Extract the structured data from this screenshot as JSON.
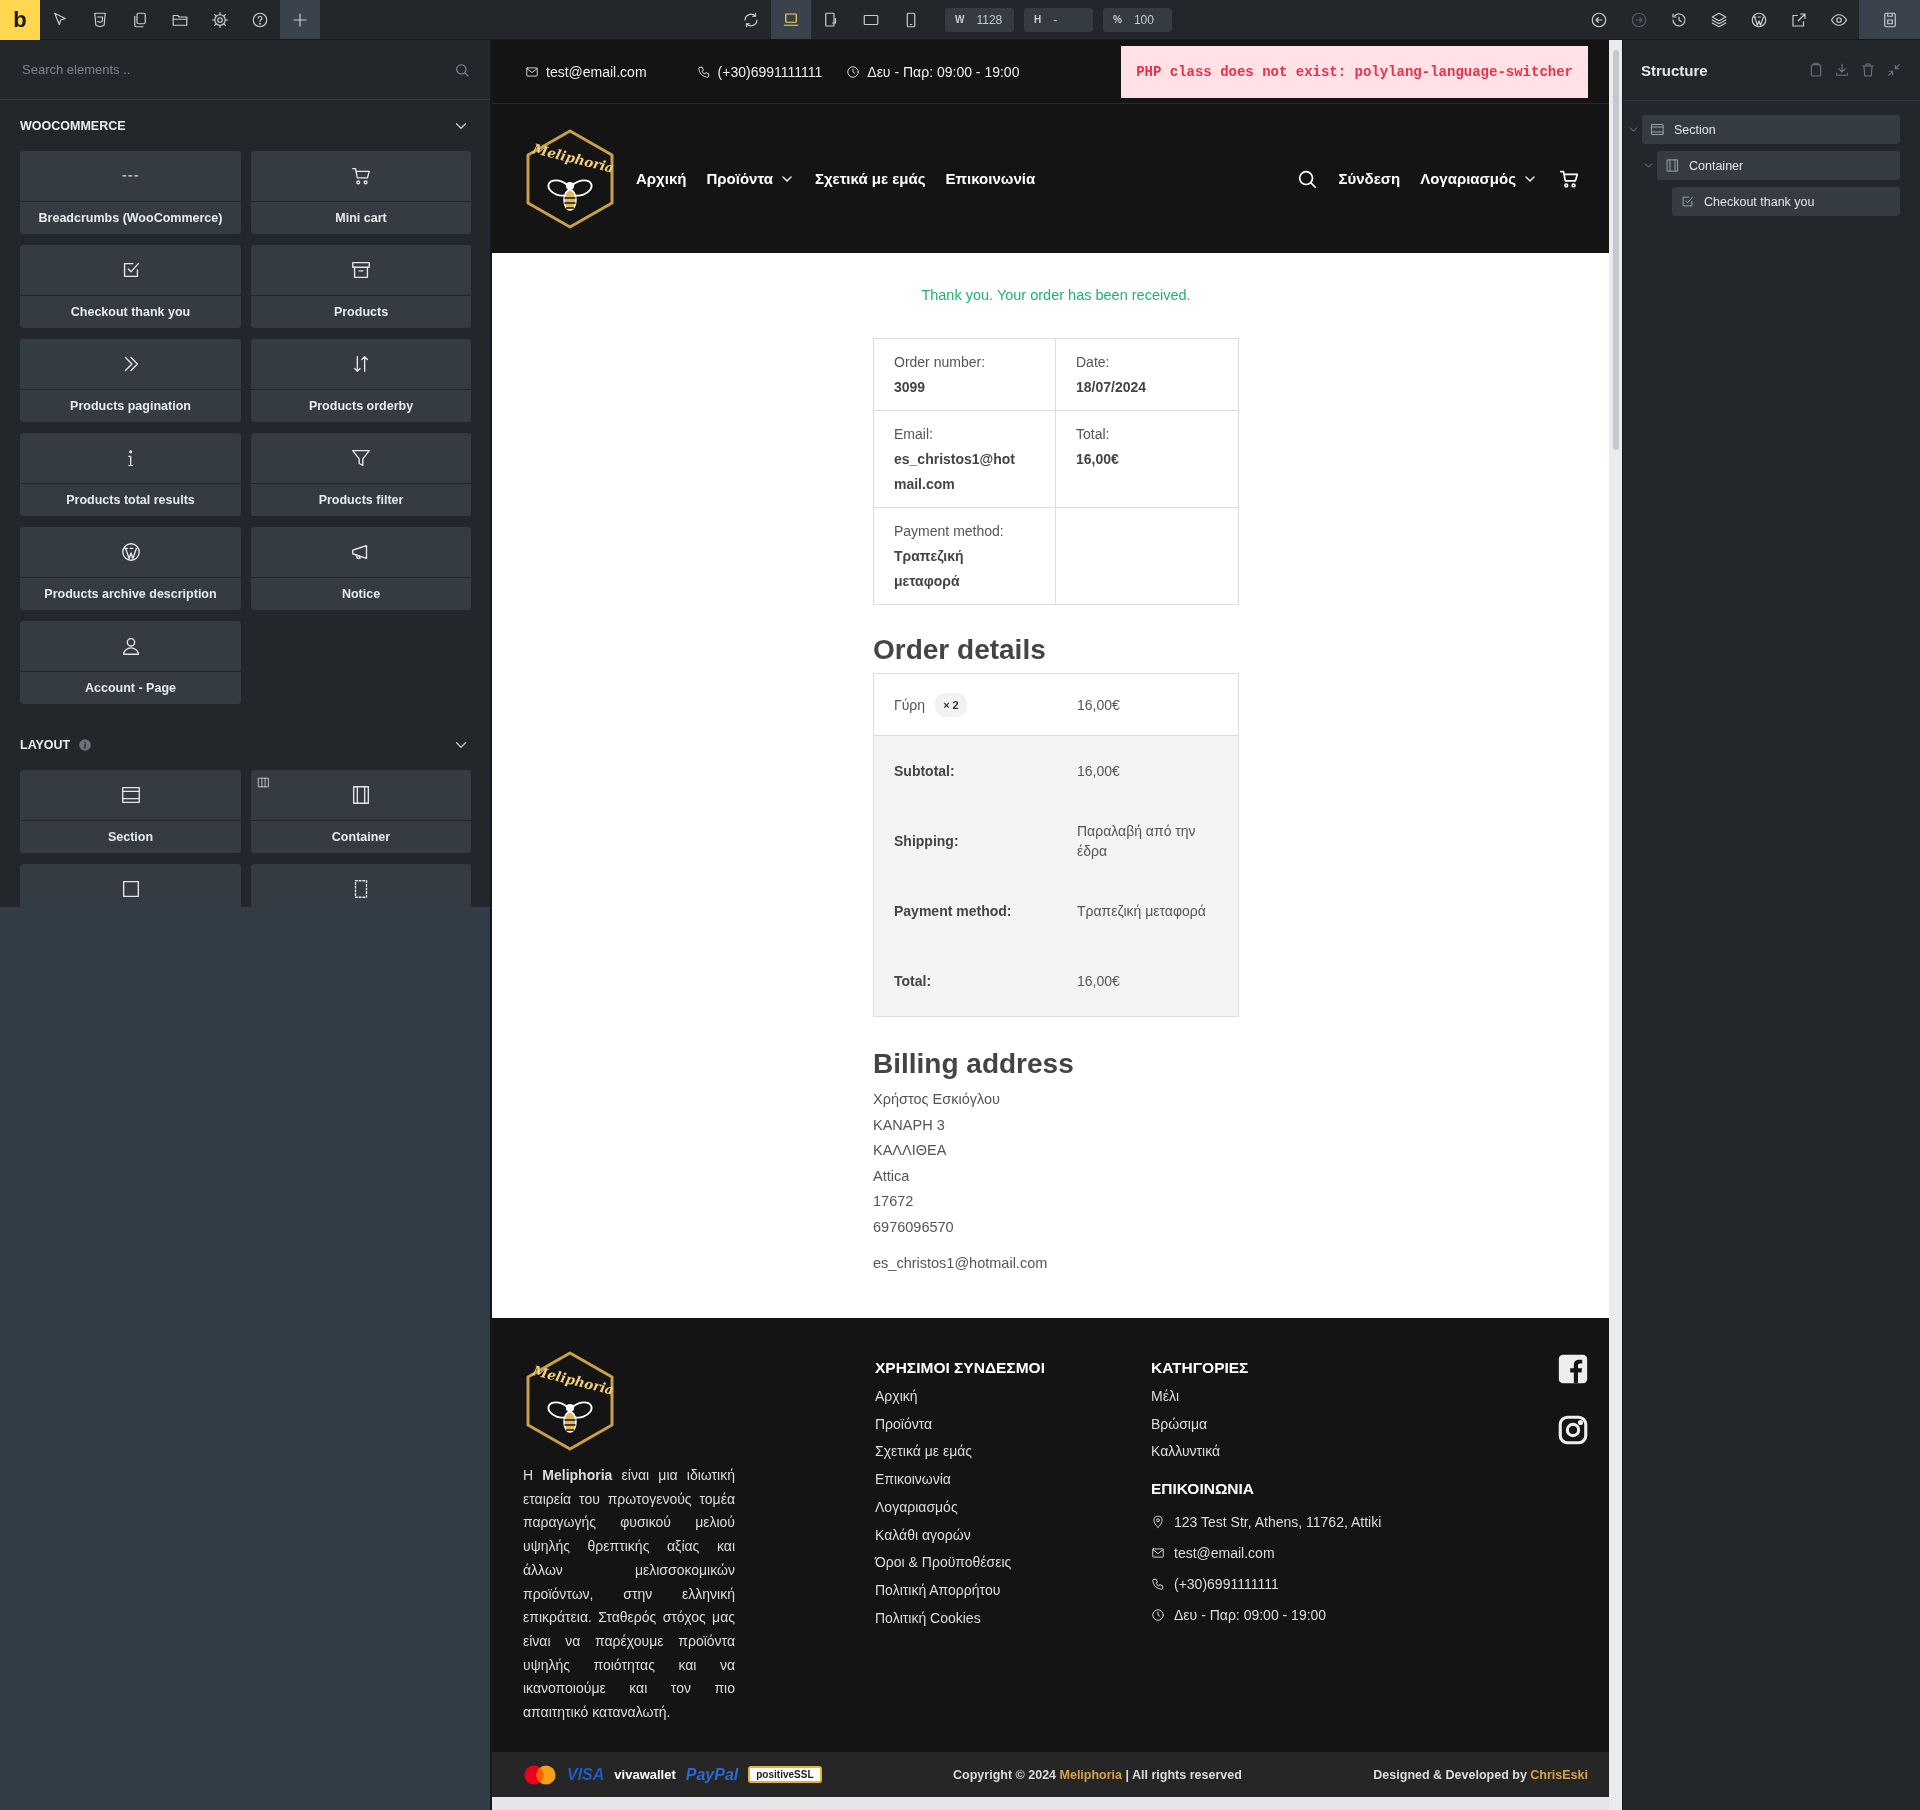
{
  "toolbar": {
    "logo": "b",
    "left_tools": [
      {
        "kind": "pointer",
        "selected": false
      },
      {
        "kind": "css3",
        "selected": false
      },
      {
        "kind": "pages",
        "selected": false
      },
      {
        "kind": "folder",
        "selected": false
      },
      {
        "kind": "gear",
        "selected": false
      },
      {
        "kind": "help",
        "selected": false
      },
      {
        "kind": "plus",
        "selected": true
      }
    ],
    "view_tools": [
      {
        "kind": "refresh",
        "selected": false
      },
      {
        "kind": "desktop",
        "selected": true
      },
      {
        "kind": "tabletrotate",
        "selected": false
      },
      {
        "kind": "tablet",
        "selected": false
      },
      {
        "kind": "phone",
        "selected": false
      }
    ],
    "size_fields": [
      {
        "label": "W",
        "value": "1128"
      },
      {
        "label": "H",
        "value": "-"
      },
      {
        "label": "%",
        "value": "100"
      }
    ],
    "right_tools": [
      {
        "kind": "undo",
        "disabled": false
      },
      {
        "kind": "redo",
        "disabled": true
      },
      {
        "kind": "history",
        "disabled": false
      },
      {
        "kind": "layers",
        "disabled": false
      },
      {
        "kind": "wordpress",
        "disabled": false
      },
      {
        "kind": "external",
        "disabled": false
      },
      {
        "kind": "eye",
        "disabled": false
      },
      {
        "kind": "save",
        "disabled": false
      }
    ]
  },
  "elements_panel": {
    "search": {
      "placeholder": "Search elements .."
    },
    "groups": [
      {
        "title": "WOOCOMMERCE",
        "info": false,
        "expanded": true,
        "items": [
          {
            "kind": "dashes",
            "label": "Breadcrumbs (WooCommerce)"
          },
          {
            "kind": "cart",
            "label": "Mini cart"
          },
          {
            "kind": "checkbox",
            "label": "Checkout thank you"
          },
          {
            "kind": "archive",
            "label": "Products"
          },
          {
            "kind": "chevrons",
            "label": "Products pagination"
          },
          {
            "kind": "sort",
            "label": "Products orderby"
          },
          {
            "kind": "info",
            "label": "Products total results"
          },
          {
            "kind": "funnel",
            "label": "Products filter"
          },
          {
            "kind": "wordpress",
            "label": "Products archive description"
          },
          {
            "kind": "megaphone",
            "label": "Notice"
          },
          {
            "kind": "user",
            "label": "Account - Page"
          }
        ]
      },
      {
        "title": "LAYOUT",
        "info": true,
        "expanded": true,
        "items": [
          {
            "kind": "section",
            "label": "Section",
            "corner": false
          },
          {
            "kind": "container",
            "label": "Container",
            "corner": true
          },
          {
            "kind": "block",
            "corner": false
          },
          {
            "kind": "div",
            "corner": false
          }
        ]
      }
    ]
  },
  "site": {
    "topbar": {
      "contacts": [
        {
          "kind": "mail",
          "text": "test@email.com"
        },
        {
          "kind": "phonecall",
          "text": "(+30)6991111111"
        },
        {
          "kind": "clock",
          "text": "Δευ - Παρ: 09:00 - 19:00"
        }
      ],
      "error": "PHP class does not exist: polylang-language-switcher"
    },
    "header": {
      "logo": "Meliphoria",
      "nav": [
        {
          "label": "Αρχική",
          "dropdown": false
        },
        {
          "label": "Προϊόντα",
          "dropdown": true
        },
        {
          "label": "Σχετικά με εμάς",
          "dropdown": false
        },
        {
          "label": "Επικοινωνία",
          "dropdown": false
        }
      ],
      "login": "Σύνδεση",
      "account": {
        "label": "Λογαριασμός",
        "dropdown": true
      }
    },
    "order": {
      "notice": "Thank you. Your order has been received.",
      "overview": [
        {
          "label": "Order number:",
          "value": "3099"
        },
        {
          "label": "Date:",
          "value": "18/07/2024"
        },
        {
          "label": "Email:",
          "value": "es_christos1@hotmail.com"
        },
        {
          "label": "Total:",
          "value": "16,00€"
        },
        {
          "label": "Payment method:",
          "value": "Τραπεζική μεταφορά"
        }
      ],
      "details_title": "Order details",
      "items": [
        {
          "name": "Γύρη",
          "quantity": "× 2",
          "total": "16,00€"
        }
      ],
      "totals": [
        {
          "label": "Subtotal:",
          "value": "16,00€"
        },
        {
          "label": "Shipping:",
          "value": "Παραλαβή από την έδρα"
        },
        {
          "label": "Payment method:",
          "value": "Τραπεζική μεταφορά"
        },
        {
          "label": "Total:",
          "value": "16,00€"
        }
      ],
      "billing_title": "Billing address",
      "billing_lines": [
        "Χρήστος Εσκιόγλου",
        "ΚΑΝΑΡΗ 3",
        "ΚΑΛΛΙΘΕΑ",
        "Attica",
        "17672",
        "6976096570"
      ],
      "billing_email": "es_christos1@hotmail.com"
    },
    "footer": {
      "logo": "Meliphoria",
      "about": "Η **Meliphoria** είναι μια ιδιωτική εταιρεία του πρωτογενούς τομέα παραγωγής φυσικού μελιού υψηλής θρεπτικής αξίας και άλλων μελισσοκομικών προϊόντων, στην ελληνική επικράτεια. Σταθερός στόχος μας είναι να παρέχουμε προϊόντα υψηλής ποιότητας και να ικανοποιούμε και τον πιο απαιτητικό καταναλωτή.",
      "links_title": "ΧΡΗΣΙΜΟΙ ΣΥΝΔΕΣΜΟΙ",
      "links": [
        "Αρχική",
        "Προϊόντα",
        "Σχετικά με εμάς",
        "Επικοινωνία",
        "Λογαριασμός",
        "Καλάθι αγορών",
        "Όροι & Προϋποθέσεις",
        "Πολιτική Απορρήτου",
        "Πολιτική Cookies"
      ],
      "categories_title": "ΚΑΤΗΓΟΡΙΕΣ",
      "categories": [
        "Μέλι",
        "Βρώσιμα",
        "Καλλυντικά"
      ],
      "contact_title": "ΕΠΙΚΟΙΝΩΝΙΑ",
      "contact": [
        {
          "kind": "pin",
          "text": "123 Test Str, Athens, 11762, Attiki"
        },
        {
          "kind": "mail",
          "text": "test@email.com"
        },
        {
          "kind": "phonecall",
          "text": "(+30)6991111111"
        },
        {
          "kind": "clock",
          "text": "Δευ - Παρ: 09:00 - 19:00"
        }
      ],
      "social": [
        {
          "kind": "facebook"
        },
        {
          "kind": "instagram"
        }
      ]
    },
    "bottom_bar": {
      "payments": [
        {
          "kind": "mastercard"
        },
        {
          "kind": "visa",
          "text": "VISA"
        },
        {
          "kind": "vivawallet",
          "text": "vivawallet"
        },
        {
          "kind": "paypal",
          "text": "PayPal"
        },
        {
          "kind": "ssl",
          "text": "positiveSSL"
        }
      ],
      "copyright": {
        "before": "Copyright © 2024 ",
        "brand": "Meliphoria",
        "after": " | All rights reserved"
      },
      "credit": {
        "before": "Designed & Developed by ",
        "brand": "ChrisEski"
      }
    }
  },
  "structure": {
    "title": "Structure",
    "actions": [
      {
        "kind": "clipboard"
      },
      {
        "kind": "download"
      },
      {
        "kind": "trash"
      },
      {
        "kind": "collapse"
      }
    ],
    "tree": [
      {
        "kind": "section",
        "label": "Section",
        "expanded": true,
        "children": [
          {
            "kind": "container",
            "label": "Container",
            "expanded": true,
            "children": [
              {
                "kind": "checkbox",
                "label": "Checkout thank you"
              }
            ]
          }
        ]
      }
    ]
  }
}
